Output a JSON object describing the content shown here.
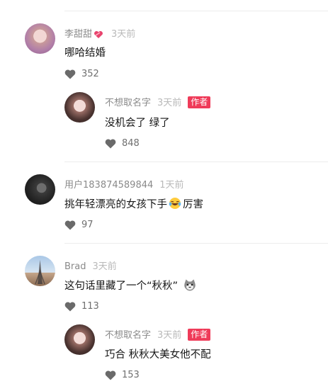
{
  "comments": [
    {
      "user": "李甜甜",
      "time": "3天前",
      "text": "哪哈结婚",
      "likes": "352",
      "badge_icon": "heart-ribbon-icon",
      "reply": {
        "user": "不想取名字",
        "time": "3天前",
        "tag": "作者",
        "text": "没机会了 绿了",
        "likes": "848"
      }
    },
    {
      "user": "用户183874589844",
      "time": "1天前",
      "text_before": "挑年轻漂亮的女孩下手",
      "emoji": "laughing-tears-emoji",
      "text_after": "厉害",
      "likes": "97"
    },
    {
      "user": "Brad",
      "time": "3天前",
      "text": "这句话里藏了一个“秋秋”",
      "emoji": "cat-face-emoji",
      "likes": "113",
      "reply": {
        "user": "不想取名字",
        "time": "3天前",
        "tag": "作者",
        "text": "巧合 秋秋大美女他不配",
        "likes": "153"
      }
    }
  ],
  "colors": {
    "author_tag": "#ef3b59",
    "username": "#8a8a8a",
    "timestamp": "#b9b9b9",
    "like_icon": "#6a6a6a"
  }
}
